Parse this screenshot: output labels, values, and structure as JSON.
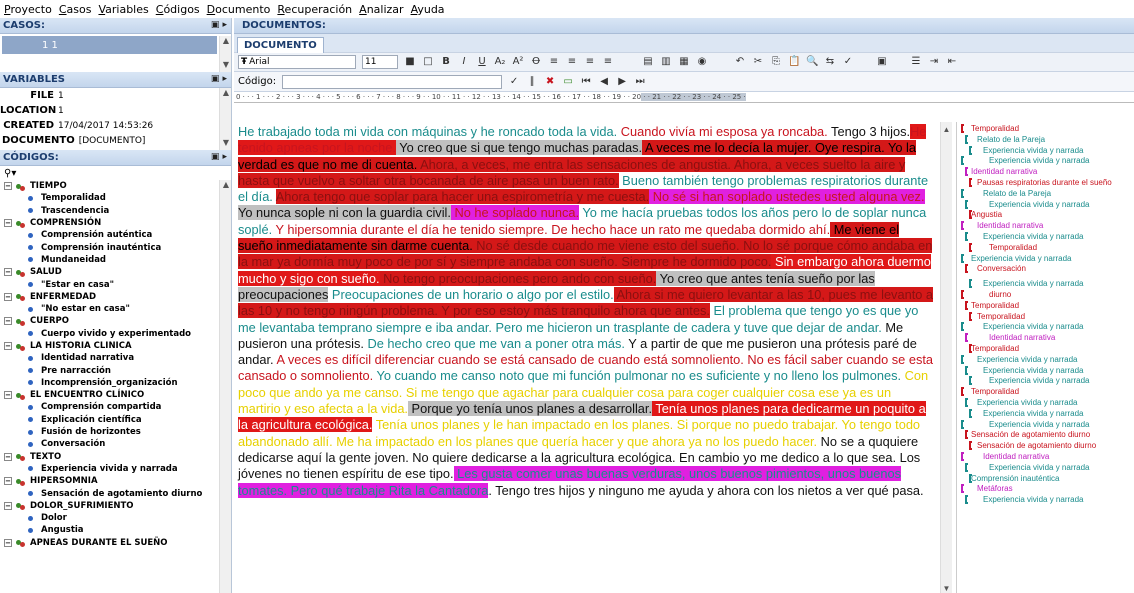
{
  "menu": [
    "Proyecto",
    "Casos",
    "Variables",
    "Códigos",
    "Documento",
    "Recuperación",
    "Analizar",
    "Ayuda"
  ],
  "casos": {
    "header": "CASOS:",
    "row": "1 1"
  },
  "variables": {
    "header": "VARIABLES",
    "rows": [
      {
        "key": "FILE",
        "value": "1"
      },
      {
        "key": "LOCATION",
        "value": "1"
      },
      {
        "key": "CREATED",
        "value": "17/04/2017 14:53:26"
      },
      {
        "key": "DOCUMENTO",
        "value": "[DOCUMENTO]"
      }
    ]
  },
  "codigos": {
    "header": "CÓDIGOS:",
    "groups": [
      {
        "name": "TIEMPO",
        "items": [
          "Temporalidad",
          "Trascendencia"
        ]
      },
      {
        "name": "COMPRENSIÓN",
        "items": [
          "Comprensión auténtica",
          "Comprensión inauténtica",
          "Mundaneidad"
        ]
      },
      {
        "name": "SALUD",
        "items": [
          "\"Estar en casa\""
        ]
      },
      {
        "name": "ENFERMEDAD",
        "items": [
          "\"No estar en casa\""
        ]
      },
      {
        "name": "CUERPO",
        "items": [
          "Cuerpo vivido y experimentado"
        ]
      },
      {
        "name": "LA HISTORIA CLINICA",
        "items": [
          "Identidad narrativa",
          "Pre narracción",
          "Incomprensión_organización"
        ]
      },
      {
        "name": "EL ENCUENTRO CLÍNICO",
        "items": [
          "Comprensión compartida",
          "Explicación científica",
          "Fusión de horizontes",
          "Conversación"
        ]
      },
      {
        "name": "TEXTO",
        "items": [
          "Experiencia vivida y narrada"
        ]
      },
      {
        "name": "HIPERSOMNIA",
        "items": [
          "Sensación de agotamiento diurno"
        ]
      },
      {
        "name": "DOLOR_SUFRIMIENTO",
        "items": [
          "Dolor",
          "Angustia"
        ]
      },
      {
        "name": "APNEAS DURANTE EL SUEÑO",
        "items": []
      }
    ]
  },
  "documentos": {
    "header": "DOCUMENTOS:",
    "tab": "DOCUMENTO",
    "font": "Arial",
    "font_size": "11",
    "code_label": "Código:",
    "ruler": "0 · · · 1 · · · 2 · · · 3 · · · 4 · · · 5 · · · 6 · · · 7 · · · 8 · · · 9 · · 10 · · 11 · · 12 · · 13 · · 14 · · 15 · · 16 · · 17 · · 18 · · 19 · · 20",
    "ruler_hl": " · · 21 · · 22 · · 23 · · 24 · · 25 ·"
  },
  "text_segments": [
    {
      "t": "He trabajado toda mi vida con máquinas y he roncado toda la vida. ",
      "c": "c-teal"
    },
    {
      "t": "Cuando vivía mi esposa ya roncaba.",
      "c": "c-red"
    },
    {
      "t": "  Tengo 3 hijos.",
      "c": "c-blk"
    },
    {
      "t": "He tenido apneas por la noche.",
      "c": "h-red"
    },
    {
      "t": " Yo creo que si que tengo muchas paradas.",
      "c": "h-gray"
    },
    {
      "t": " A veces me lo decía la mujer. Oye respira.",
      "c": "h-red-d"
    },
    {
      "t": "  Yo la verdad es que no me di cuenta.",
      "c": "h-red-d"
    },
    {
      "t": " Ahora, a veces, me entra las sensaciones de angustia. Ahora, a veces suelto la aire y hasta que vuelvo a soltar otra bocanada de aire pasa un buen rato.",
      "c": "h-red-t"
    },
    {
      "t": " Bueno también tengo problemas respiratorios durante el día. ",
      "c": "c-teal"
    },
    {
      "t": "Ahora tengo que soplar para hacer una espirometría y me cuesta.",
      "c": "h-red-t"
    },
    {
      "t": " No sé si han soplado ustedes usted alguna vez.",
      "c": "h-mag"
    },
    {
      "t": " Yo nunca sople ni con la guardia civil.",
      "c": "h-gray"
    },
    {
      "t": " No he soplado nunca.",
      "c": "h-mag"
    },
    {
      "t": "  Yo me hacía pruebas todos los años pero lo de soplar nunca soplé.",
      "c": "c-teal"
    },
    {
      "t": " Y hipersomnia durante el día he tenido siempre. De hecho hace un rato me quedaba dormido ahí.",
      "c": "c-red"
    },
    {
      "t": " Me viene el sueño inmediatamente sin darme cuenta.",
      "c": "h-red-d"
    },
    {
      "t": " No sé desde cuando me viene esto del sueño. No lo sé porque cómo andaba en la mar ya dormía muy poco de por sí y siempre andaba con sueño. Siempre he dormido poco.",
      "c": "h-red-t"
    },
    {
      "t": " Sin embargo ahora duermo mucho y sigo con sueño.",
      "c": "h-red-w"
    },
    {
      "t": " No tengo preocupaciones pero ando con sueño.",
      "c": "h-red-t"
    },
    {
      "t": " Yo creo que antes tenía sueño por las preocupaciones",
      "c": "h-gray"
    },
    {
      "t": " Preocupaciones de un horario o algo por el estilo.",
      "c": "c-teal"
    },
    {
      "t": " Ahora si me quiero levantar a las 10, pues me levanto a las 10 y no tengo ningún problema. Y por eso estoy más tranquilo ahora que antes.",
      "c": "h-red-t"
    },
    {
      "t": " El problema que tengo yo es que yo me levantaba temprano siempre e iba andar. Pero me hicieron un trasplante de cadera y tuve que dejar de andar.",
      "c": "c-teal"
    },
    {
      "t": " Me pusieron una prótesis. ",
      "c": "c-blk"
    },
    {
      "t": "De hecho creo que me van a poner otra más.",
      "c": "c-teal"
    },
    {
      "t": " Y a partir de que me pusieron una prótesis paré de andar.",
      "c": "c-blk"
    },
    {
      "t": " A veces es difícil diferenciar cuando se está cansado de cuando está somnoliento. No es fácil saber cuando se esta cansado o somnoliento.",
      "c": "c-red"
    },
    {
      "t": " Yo cuando me canso noto que mi función pulmonar no es suficiente y no lleno los pulmones.",
      "c": "c-teal"
    },
    {
      "t": " Con poco que ando ya me canso. Si me tengo que agachar para cualquier cosa para coger cualquier cosa ese ya es un martirio y eso afecta a la vida.",
      "c": "c-yel"
    },
    {
      "t": " Porque yo tenía unos planes a desarrollar.",
      "c": "h-gray"
    },
    {
      "t": " Tenía unos planes para dedicarme un poquito a la agricultura ecológica.",
      "c": "h-red-w"
    },
    {
      "t": " Tenía unos planes y le han impactado en los planes. Si porque no puedo trabajar. Yo tengo todo abandonado allí.  Me ha impactado en los planes que quería hacer y que ahora ya no los puedo hacer.",
      "c": "c-yel"
    },
    {
      "t": " No se a ququiere dedicarse aquí la gente joven. No quiere dedicarse  a la agricultura ecológica. En cambio yo me dedico a lo que sea. Los jóvenes no tienen espíritu de ese tipo.",
      "c": "c-blk"
    },
    {
      "t": " Les gusta comer unas buenas verduras, unos buenos pimientos, unos buenos tomates. Pero qué trabaje Rita la Cantadora",
      "c": "h-mag-t"
    },
    {
      "t": ". Tengo tres hijos y ninguno me ayuda y ahora con los nietos a ver qué pasa.",
      "c": "c-blk"
    }
  ],
  "margin_codes": [
    {
      "t": "Temporalidad",
      "c": "#c8141e"
    },
    {
      "t": "Relato de la Pareja",
      "c": "#1a8c8c"
    },
    {
      "t": "Experiencia vivida y narrada",
      "c": "#1a8c8c"
    },
    {
      "t": "Experiencia vivida y narrada",
      "c": "#1a8c8c"
    },
    {
      "t": "Identidad narrativa",
      "c": "#c020c0"
    },
    {
      "t": "Pausas respiratorias durante el sueño",
      "c": "#c8141e"
    },
    {
      "t": "Relato de la Pareja",
      "c": "#1a8c8c"
    },
    {
      "t": "Experiencia vivida y narrada",
      "c": "#1a8c8c"
    },
    {
      "t": "Angustia",
      "c": "#c8141e"
    },
    {
      "t": "Identidad narrativa",
      "c": "#c020c0"
    },
    {
      "t": "Experiencia vivida y narrada",
      "c": "#1a8c8c"
    },
    {
      "t": "Temporalidad",
      "c": "#c8141e"
    },
    {
      "t": "Experiencia vivida y narrada",
      "c": "#1a8c8c"
    },
    {
      "t": "Conversación",
      "c": "#c8141e"
    },
    {
      "t": "Experiencia vivida y narrada",
      "c": "#1a8c8c"
    },
    {
      "t": "diurno",
      "c": "#c8141e"
    },
    {
      "t": "Temporalidad",
      "c": "#c8141e"
    },
    {
      "t": "Temporalidad",
      "c": "#c8141e"
    },
    {
      "t": "Experiencia vivida y narrada",
      "c": "#1a8c8c"
    },
    {
      "t": "Identidad narrativa",
      "c": "#c020c0"
    },
    {
      "t": "Temporalidad",
      "c": "#c8141e"
    },
    {
      "t": "Experiencia vivida y narrada",
      "c": "#1a8c8c"
    },
    {
      "t": "Experiencia vivida y narrada",
      "c": "#1a8c8c"
    },
    {
      "t": "Experiencia vivida y narrada",
      "c": "#1a8c8c"
    },
    {
      "t": "Temporalidad",
      "c": "#c8141e"
    },
    {
      "t": "Experiencia vivida y narrada",
      "c": "#1a8c8c"
    },
    {
      "t": "Experiencia vivida y narrada",
      "c": "#1a8c8c"
    },
    {
      "t": "Experiencia vivida y narrada",
      "c": "#1a8c8c"
    },
    {
      "t": "Sensación de agotamiento diurno",
      "c": "#c8141e"
    },
    {
      "t": "Sensación de agotamiento diurno",
      "c": "#c8141e"
    },
    {
      "t": "Identidad narrativa",
      "c": "#c020c0"
    },
    {
      "t": "Experiencia vivida y narrada",
      "c": "#1a8c8c"
    },
    {
      "t": "Comprensión inauténtica",
      "c": "#1a8c8c"
    },
    {
      "t": "Metáforas",
      "c": "#c020c0"
    },
    {
      "t": "Experiencia vivida y narrada",
      "c": "#1a8c8c"
    }
  ]
}
